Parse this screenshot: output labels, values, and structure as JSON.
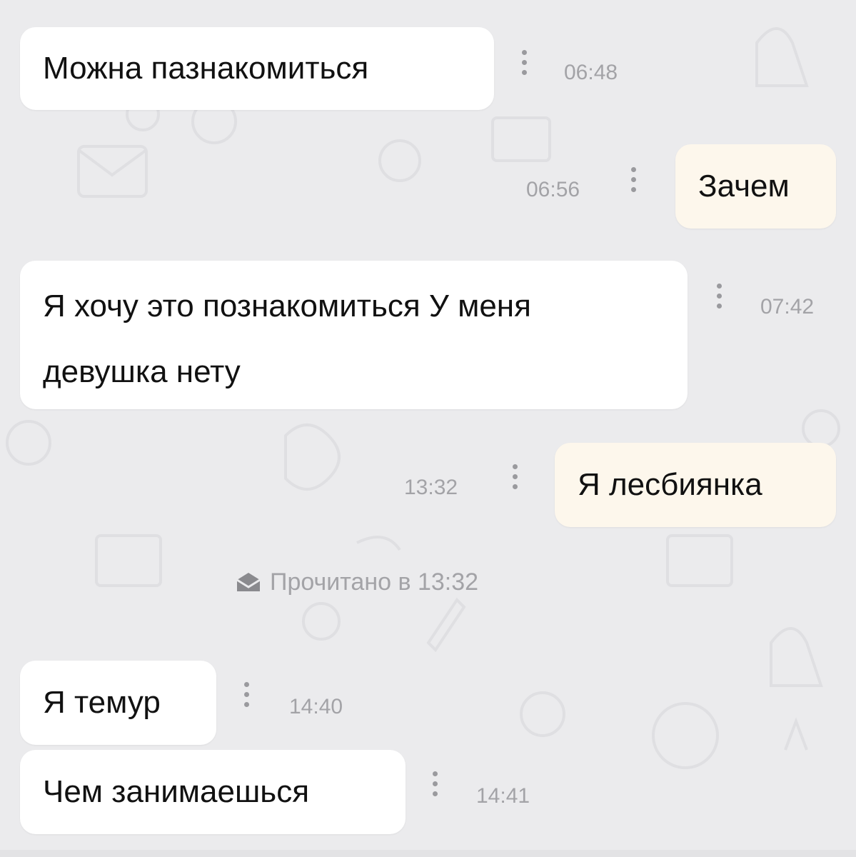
{
  "messages": [
    {
      "text": "Можна пазнакомиться",
      "time": "06:48",
      "direction": "incoming"
    },
    {
      "text": "Зачем",
      "time": "06:56",
      "direction": "outgoing"
    },
    {
      "text": "Я хочу это познакомиться У меня девушка нету",
      "time": "07:42",
      "direction": "incoming"
    },
    {
      "text": "Я лесбиянка",
      "time": "13:32",
      "direction": "outgoing"
    },
    {
      "text": "Я темур",
      "time": "14:40",
      "direction": "incoming"
    },
    {
      "text": "Чем занимаешься",
      "time": "14:41",
      "direction": "incoming"
    }
  ],
  "read_status": {
    "label": "Прочитано в 13:32",
    "icon": "opened-envelope-icon"
  },
  "colors": {
    "background": "#ebebed",
    "incoming_bubble": "#ffffff",
    "outgoing_bubble": "#fdf7ec",
    "timestamp": "#a3a3a7"
  }
}
